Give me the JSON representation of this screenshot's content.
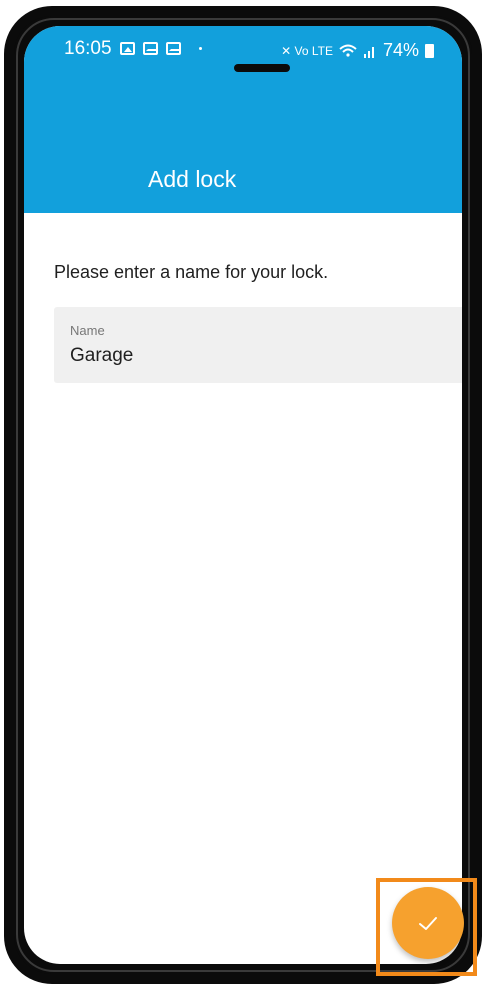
{
  "status_bar": {
    "time": "16:05",
    "left_icons": [
      "image-icon",
      "mail-icon",
      "mail-outline-icon"
    ],
    "network_glyphs": "✕ Vo LTE",
    "battery_percent": "74%"
  },
  "app_bar": {
    "title": "Add lock",
    "color": "#12a0dc"
  },
  "form": {
    "prompt": "Please enter a name for your lock.",
    "name_field": {
      "label": "Name",
      "value": "Garage"
    }
  },
  "fab": {
    "icon": "check-icon",
    "color": "#f6a12e",
    "highlight_color": "#f28a1a"
  }
}
